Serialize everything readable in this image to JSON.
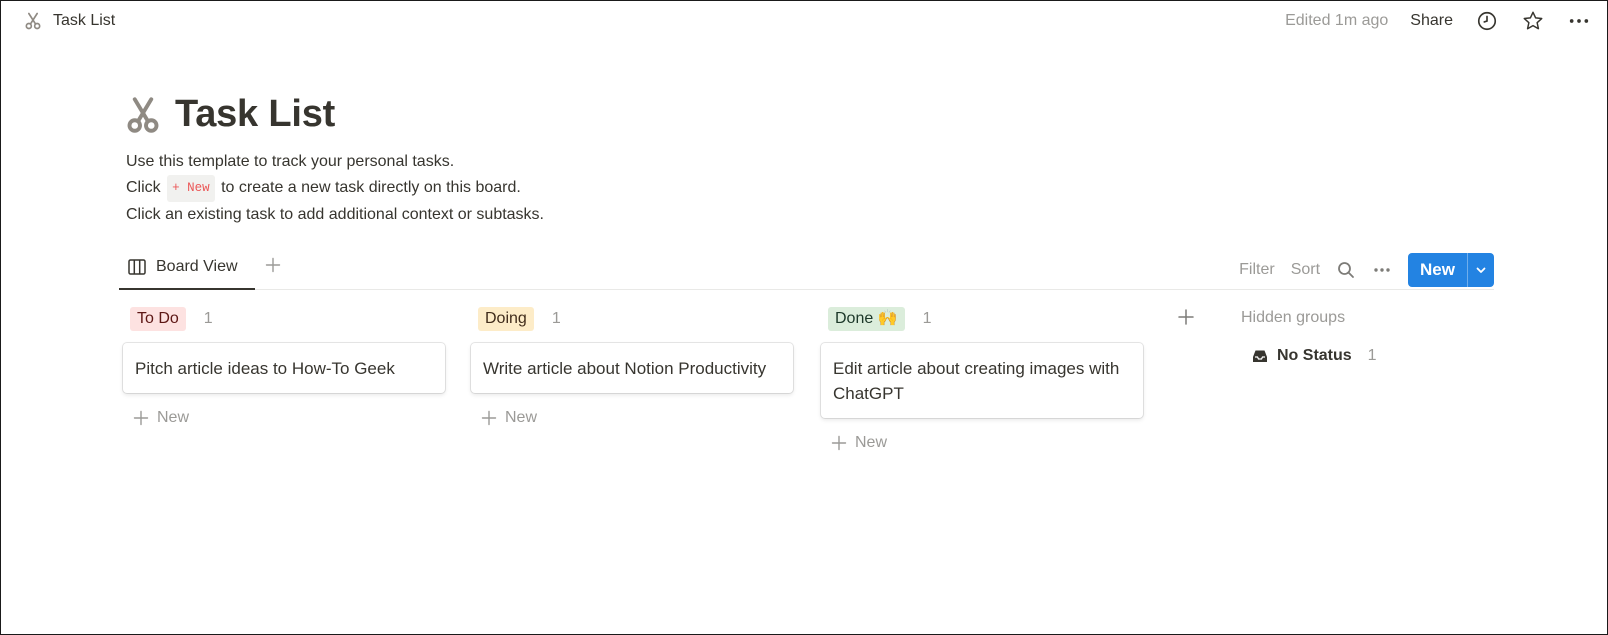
{
  "topbar": {
    "breadcrumb_title": "Task List",
    "edited": "Edited 1m ago",
    "share": "Share",
    "icons": [
      "clock-icon",
      "star-icon",
      "more-icon"
    ]
  },
  "page": {
    "icon": "scissors-icon",
    "title": "Task List",
    "desc": {
      "line1": "Use this template to track your personal tasks.",
      "line2_before": "Click",
      "line2_code": "+ New",
      "line2_after": "to create a new task directly on this board.",
      "line3": "Click an existing task to add additional context or subtasks."
    }
  },
  "viewbar": {
    "tab_label": "Board View",
    "filter": "Filter",
    "sort": "Sort",
    "new_label": "New"
  },
  "board": {
    "columns": [
      {
        "name": "To Do",
        "count": "1",
        "tag_bg": "#fde2e1",
        "tag_color": "#5d1715",
        "cards": [
          "Pitch article ideas to How-To Geek"
        ],
        "add_label": "New"
      },
      {
        "name": "Doing",
        "count": "1",
        "tag_bg": "#fdecc8",
        "tag_color": "#402c1b",
        "cards": [
          "Write article about Notion Productivity"
        ],
        "add_label": "New"
      },
      {
        "name": "Done 🙌",
        "count": "1",
        "tag_bg": "#dbeddb",
        "tag_color": "#1c3829",
        "cards": [
          "Edit article about creating images with ChatGPT"
        ],
        "add_label": "New"
      }
    ],
    "hidden_groups": "Hidden groups",
    "no_status": {
      "label": "No Status",
      "count": "1"
    }
  },
  "colors": {
    "accent": "#2383e2",
    "text": "#37352f",
    "muted": "#9b9a97"
  }
}
